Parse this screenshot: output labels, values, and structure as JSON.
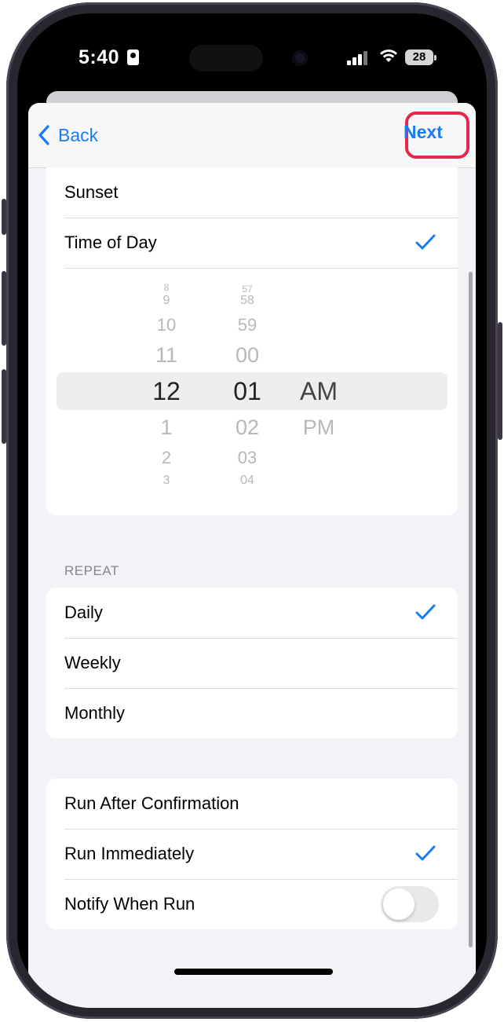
{
  "status_bar": {
    "time": "5:40",
    "battery": "28",
    "icons": [
      "person-icon",
      "signal-icon",
      "wifi-icon",
      "battery-icon"
    ]
  },
  "navbar": {
    "back_label": "Back",
    "next_label": "Next",
    "accent_color": "#1a7cf5",
    "highlight_color": "#e8264b"
  },
  "trigger_options": {
    "items": [
      {
        "label": "Sunset",
        "checked": false
      },
      {
        "label": "Time of Day",
        "checked": true
      }
    ]
  },
  "time_picker": {
    "hours": {
      "above": [
        "9",
        "10",
        "11"
      ],
      "selected": "12",
      "below": [
        "1",
        "2",
        "3"
      ]
    },
    "minutes": {
      "above": [
        "58",
        "59",
        "00"
      ],
      "selected": "01",
      "below": [
        "02",
        "03",
        "04"
      ]
    },
    "period": {
      "selected": "AM",
      "below": [
        "PM"
      ]
    }
  },
  "repeat": {
    "header": "REPEAT",
    "items": [
      {
        "label": "Daily",
        "checked": true
      },
      {
        "label": "Weekly",
        "checked": false
      },
      {
        "label": "Monthly",
        "checked": false
      }
    ]
  },
  "run_options": {
    "items": [
      {
        "label": "Run After Confirmation",
        "checked": false
      },
      {
        "label": "Run Immediately",
        "checked": true
      }
    ],
    "notify": {
      "label": "Notify When Run",
      "enabled": false
    }
  }
}
